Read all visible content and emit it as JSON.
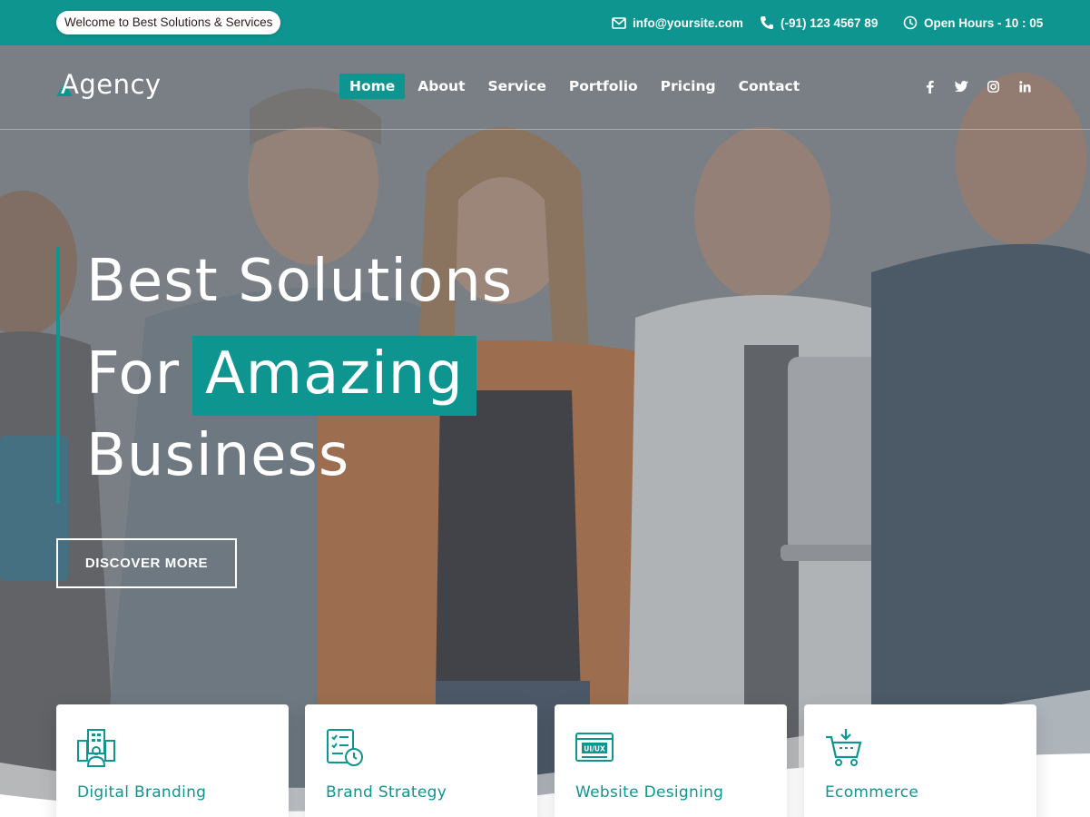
{
  "topbar": {
    "welcome": "Welcome to Best Solutions & Services",
    "email": "info@yoursite.com",
    "phone": "(-91) 123 4567 89",
    "hours": "Open Hours - 10 : 05"
  },
  "header": {
    "logo": "Agency",
    "nav": [
      "Home",
      "About",
      "Service",
      "Portfolio",
      "Pricing",
      "Contact"
    ],
    "active_nav": "Home",
    "social": [
      "facebook-icon",
      "twitter-icon",
      "instagram-icon",
      "linkedin-icon"
    ]
  },
  "hero": {
    "line1": "Best Solutions",
    "line2_prefix": "For",
    "line2_highlight": "Amazing",
    "line3": "Business",
    "cta": "DISCOVER MORE"
  },
  "services": [
    {
      "title": "Digital Branding",
      "icon": "building-team-icon"
    },
    {
      "title": "Brand Strategy",
      "icon": "checklist-clock-icon"
    },
    {
      "title": "Website Designing",
      "icon": "ui-ux-screen-icon"
    },
    {
      "title": "Ecommerce",
      "icon": "shopping-cart-icon"
    }
  ],
  "colors": {
    "accent": "#0e9590",
    "white": "#ffffff",
    "text_dark": "#2b1d1d"
  }
}
